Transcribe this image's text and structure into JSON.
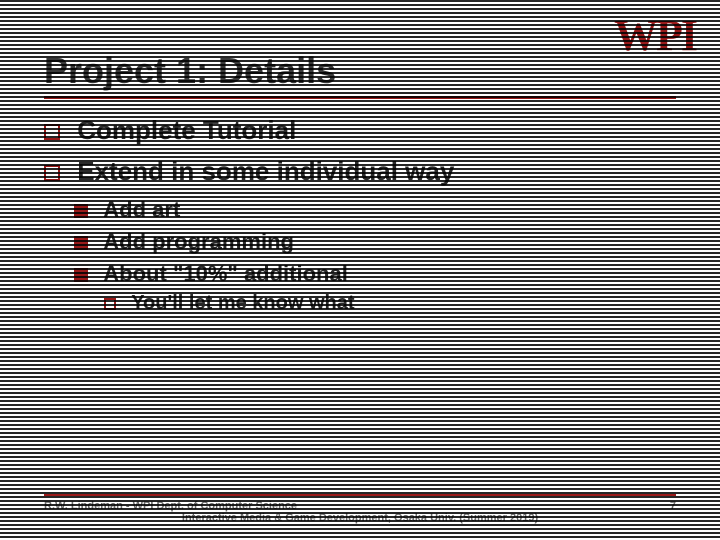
{
  "brand": {
    "logo_text": "WPI",
    "accent_color": "#9a1b1b"
  },
  "slide": {
    "title": "Project 1: Details",
    "bullets": {
      "b1": {
        "text": "Complete Tutorial"
      },
      "b2": {
        "text": "Extend in some individual way",
        "sub": {
          "s1": {
            "text": "Add art"
          },
          "s2": {
            "text": "Add programming"
          },
          "s3": {
            "text": "About \"10%\" additional",
            "sub": {
              "t1": {
                "text": "You'll let me know what"
              }
            }
          }
        }
      }
    }
  },
  "footer": {
    "line1": "R.W. Lindeman - WPI Dept. of Computer Science",
    "line2": "Interactive Media & Game Development, Osaka Univ. (Summer 2019)",
    "page": "7"
  }
}
